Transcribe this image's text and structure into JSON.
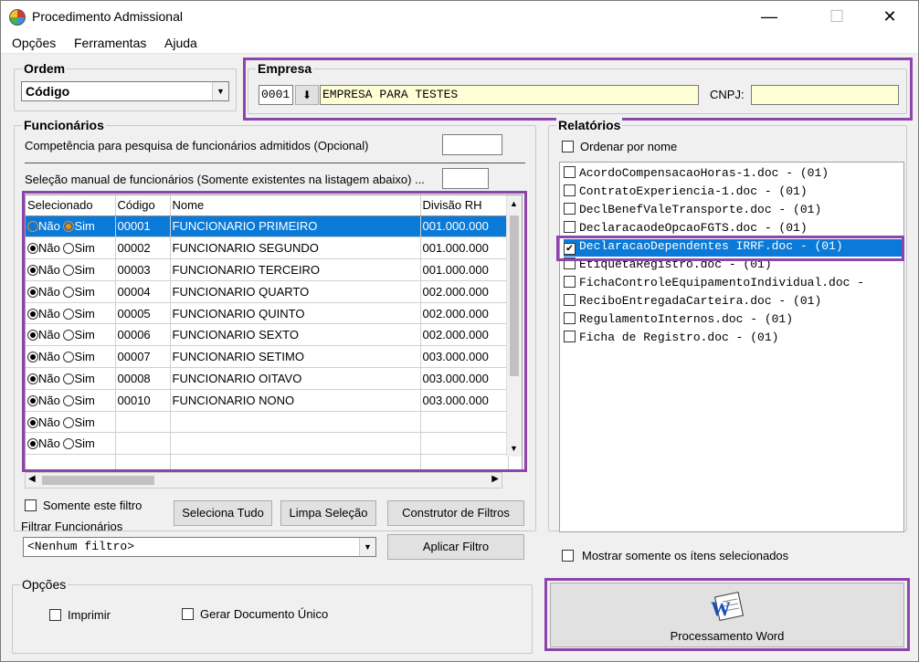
{
  "window": {
    "title": "Procedimento Admissional",
    "minimize": "—",
    "maximize": "☐",
    "close": "✕"
  },
  "menu": [
    "Opções",
    "Ferramentas",
    "Ajuda"
  ],
  "ordem": {
    "label": "Ordem",
    "value": "Código"
  },
  "empresa": {
    "label": "Empresa",
    "code": "0001",
    "name": "EMPRESA PARA TESTES",
    "cnpj_label": "CNPJ:",
    "cnpj_value": ""
  },
  "funcionarios": {
    "label": "Funcionários",
    "competencia_label": "Competência para pesquisa de funcionários admitidos (Opcional)",
    "selecao_label": "Seleção manual de funcionários (Somente existentes na listagem abaixo) ...",
    "columns": [
      "Selecionado",
      "Código",
      "Nome",
      "Divisão RH"
    ],
    "radio_nao": "Não",
    "radio_sim": "Sim",
    "rows": [
      {
        "codigo": "00001",
        "nome": "FUNCIONARIO PRIMEIRO",
        "divisao": "001.000.000",
        "sim": true
      },
      {
        "codigo": "00002",
        "nome": "FUNCIONARIO SEGUNDO",
        "divisao": "001.000.000",
        "sim": false
      },
      {
        "codigo": "00003",
        "nome": "FUNCIONARIO TERCEIRO",
        "divisao": "001.000.000",
        "sim": false
      },
      {
        "codigo": "00004",
        "nome": "FUNCIONARIO QUARTO",
        "divisao": "002.000.000",
        "sim": false
      },
      {
        "codigo": "00005",
        "nome": "FUNCIONARIO QUINTO",
        "divisao": "002.000.000",
        "sim": false
      },
      {
        "codigo": "00006",
        "nome": "FUNCIONARIO SEXTO",
        "divisao": "002.000.000",
        "sim": false
      },
      {
        "codigo": "00007",
        "nome": "FUNCIONARIO SETIMO",
        "divisao": "003.000.000",
        "sim": false
      },
      {
        "codigo": "00008",
        "nome": "FUNCIONARIO OITAVO",
        "divisao": "003.000.000",
        "sim": false
      },
      {
        "codigo": "00010",
        "nome": "FUNCIONARIO NONO",
        "divisao": "003.000.000",
        "sim": false
      },
      {
        "codigo": "",
        "nome": "",
        "divisao": "",
        "sim": false
      },
      {
        "codigo": "",
        "nome": "",
        "divisao": "",
        "sim": false
      }
    ],
    "somente_filtro": "Somente este filtro",
    "filtrar_label": "Filtrar Funcionários",
    "filtro_value": "<Nenhum filtro>",
    "btn_seleciona": "Seleciona Tudo",
    "btn_limpa": "Limpa Seleção",
    "btn_construtor": "Construtor de Filtros",
    "btn_aplicar": "Aplicar Filtro"
  },
  "relatorios": {
    "label": "Relatórios",
    "ordenar": "Ordenar por nome",
    "items": [
      {
        "text": "AcordoCompensacaoHoras-1.doc - (01)",
        "checked": false
      },
      {
        "text": "ContratoExperiencia-1.doc - (01)",
        "checked": false
      },
      {
        "text": "DeclBenefValeTransporte.doc - (01)",
        "checked": false
      },
      {
        "text": "DeclaracaodeOpcaoFGTS.doc - (01)",
        "checked": false
      },
      {
        "text": "DeclaracaoDependentes IRRF.doc - (01)",
        "checked": true
      },
      {
        "text": "EtiquetaRegistro.doc - (01)",
        "checked": false
      },
      {
        "text": "FichaControleEquipamentoIndividual.doc -",
        "checked": false
      },
      {
        "text": "ReciboEntregadaCarteira.doc - (01)",
        "checked": false
      },
      {
        "text": "RegulamentoInternos.doc - (01)",
        "checked": false
      },
      {
        "text": "Ficha de Registro.doc - (01)",
        "checked": false
      }
    ],
    "mostrar": "Mostrar somente os ítens selecionados"
  },
  "opcoes": {
    "label": "Opções",
    "imprimir": "Imprimir",
    "gerar": "Gerar Documento Único"
  },
  "processamento": {
    "label": "Processamento Word",
    "icon": "word-icon"
  },
  "colors": {
    "highlight": "#8e44ad",
    "selection": "#0a7ad8",
    "field_yellow": "#ffffd6"
  }
}
